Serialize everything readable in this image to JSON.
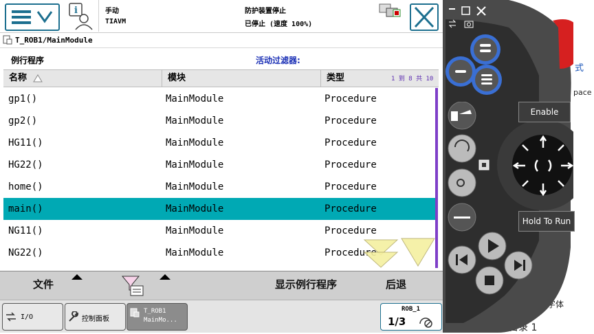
{
  "status": {
    "mode": "手动",
    "system": "TIAVM",
    "safety": "防护装置停止",
    "state": "已停止 (速度 100%)"
  },
  "window": {
    "path": "T_ROB1/MainModule",
    "heading": "例行程序",
    "filter_label": "活动过滤器:"
  },
  "table": {
    "headers": [
      "名称",
      "模块",
      "类型"
    ],
    "range": "1 到 8 共 10",
    "rows": [
      {
        "name": "gp1()",
        "module": "MainModule",
        "type": "Procedure"
      },
      {
        "name": "gp2()",
        "module": "MainModule",
        "type": "Procedure"
      },
      {
        "name": "HG11()",
        "module": "MainModule",
        "type": "Procedure"
      },
      {
        "name": "HG22()",
        "module": "MainModule",
        "type": "Procedure"
      },
      {
        "name": "home()",
        "module": "MainModule",
        "type": "Procedure"
      },
      {
        "name": "main()",
        "module": "MainModule",
        "type": "Procedure"
      },
      {
        "name": "NG11()",
        "module": "MainModule",
        "type": "Procedure"
      },
      {
        "name": "NG22()",
        "module": "MainModule",
        "type": "Procedure"
      }
    ],
    "selected_index": 5
  },
  "commands": {
    "file": "文件",
    "show_routine": "显示例行程序",
    "back": "后退"
  },
  "taskbar": {
    "io": "I/O",
    "control_panel": "控制面板",
    "tab_line1": "T_ROB1",
    "tab_line2": "MainMo...",
    "robot": "ROB_1",
    "fraction": "1/3"
  },
  "pendant": {
    "enable": "Enable",
    "hold_to_run": "Hold To Run",
    "bg_text_1": "式",
    "bg_text_2": "pace",
    "bg_text_3": "略字体",
    "bg_text_4": "目录 1"
  },
  "colors": {
    "selected_row": "#00a9b4",
    "accent": "#1c6f8f",
    "pendant_blue": "#3a6fd4"
  }
}
